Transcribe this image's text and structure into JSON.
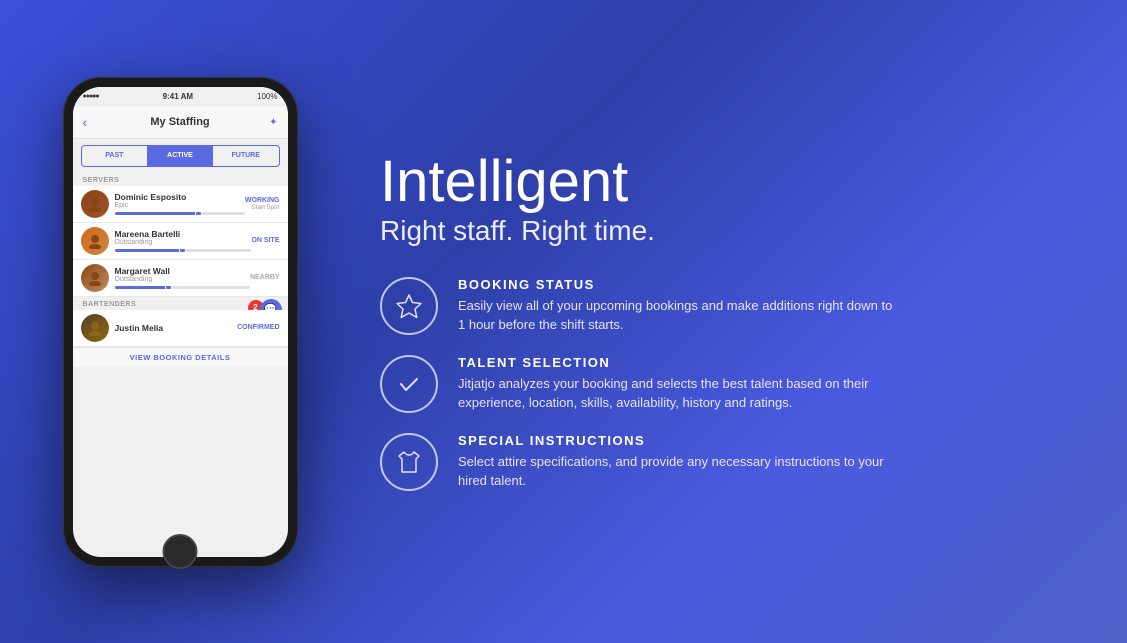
{
  "background": {
    "color_primary": "#3a50d9",
    "color_secondary": "#2e3fa8"
  },
  "headline": {
    "main": "Intelligent",
    "sub": "Right staff. Right time."
  },
  "features": [
    {
      "id": "booking-status",
      "title": "BOOKING STATUS",
      "description": "Easily view all of your upcoming bookings and make additions right down to 1 hour before the shift starts.",
      "icon": "star"
    },
    {
      "id": "talent-selection",
      "title": "TALENT SELECTION",
      "description": "Jitjatjo analyzes your booking and selects the best talent based on their experience, location, skills, availability, history and ratings.",
      "icon": "check"
    },
    {
      "id": "special-instructions",
      "title": "SPECIAL INSTRUCTIONS",
      "description": "Select attire specifications, and provide any necessary instructions to your hired talent.",
      "icon": "shirt"
    }
  ],
  "phone": {
    "status_bar": {
      "signal": "●●●●●",
      "wifi": "WiFi",
      "time": "9:41 AM",
      "battery": "100%"
    },
    "nav": {
      "title": "My Staffing",
      "back_icon": "‹",
      "right_icon": "⊕"
    },
    "tabs": [
      {
        "label": "PAST",
        "active": false
      },
      {
        "label": "ACTIVE",
        "active": true
      },
      {
        "label": "FUTURE",
        "active": false
      }
    ],
    "servers_label": "SERVERS",
    "staff": [
      {
        "name": "Dominic Esposito",
        "sub": "Epic",
        "status": "WORKING",
        "status_class": "working",
        "time": "Start 5pm",
        "progress": 65
      },
      {
        "name": "Mareena Bartelli",
        "sub": "Outstanding",
        "status": "ON SITE",
        "status_class": "onsite",
        "time": "",
        "progress": 50
      },
      {
        "name": "Margaret Wall",
        "sub": "Outstanding",
        "status": "NEARBY",
        "status_class": "nearby",
        "time": "",
        "progress": 40
      }
    ],
    "bartenders_label": "BARTENDERS",
    "notification_count": "2",
    "bartender": {
      "name": "Justin Melia",
      "sub": "",
      "status": "CONFIRMED",
      "status_class": "confirmed"
    },
    "view_booking_btn": "VIEW BOOKING DETAILS"
  }
}
